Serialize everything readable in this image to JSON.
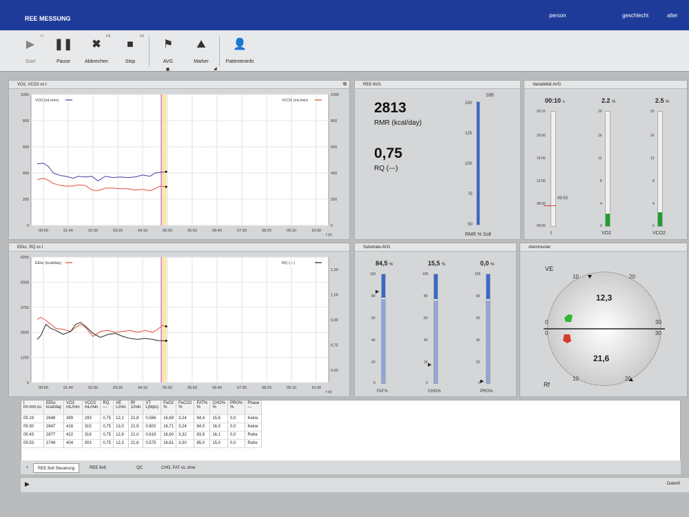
{
  "app": {
    "title": "REE MESSUNG",
    "meta": [
      "person",
      "geschlecht",
      "alter"
    ]
  },
  "toolbar": {
    "buttons": [
      {
        "label": "Start",
        "icon": "play-icon",
        "key": "F5"
      },
      {
        "label": "Pause",
        "icon": "pause-icon",
        "key": ""
      },
      {
        "label": "Abbrechen",
        "icon": "cancel-icon",
        "key": "F8"
      },
      {
        "label": "Stop",
        "icon": "stop-icon",
        "key": "F6"
      },
      {
        "label": "AVG",
        "icon": "flag-icon",
        "key": ""
      },
      {
        "label": "Marker",
        "icon": "marker-icon",
        "key": ""
      },
      {
        "label": "Patienteninfo",
        "icon": "patient-info-icon",
        "key": ""
      }
    ]
  },
  "panels": {
    "vo2": {
      "title": "VO2, VCO2 vs t",
      "legend_left": "VO2 (mL/min)",
      "legend_right": "VCO2 (mL/min)"
    },
    "eekc": {
      "title": "EEkc, RQ vs t",
      "legend_left": "EEkc (kcal/day)",
      "legend_right": "RQ (---)"
    },
    "ree": {
      "title": "REE AVG",
      "value1": "2813",
      "unit1": "RMR (kcal/day)",
      "value2": "0,75",
      "unit2": "RQ (---)",
      "bar_top_label": "186",
      "bar_bottom_label": "RMR % Soll",
      "ticks": [
        "150",
        "125",
        "100",
        "75",
        "50"
      ]
    },
    "var": {
      "title": "Variabilität AVG",
      "t_value": "00:10",
      "t_unit": "s",
      "vo2_value": "2.2",
      "vo2_unit": "%",
      "vco2_value": "2.5",
      "vco2_unit": "%",
      "marker": "05:53",
      "labels": [
        "t",
        "VO2",
        "VCO2"
      ],
      "t_ticks": [
        "00:10",
        "20:00",
        "16:00",
        "12:00",
        "08:00",
        "00:00"
      ],
      "pct_ticks": [
        "20",
        "16",
        "12",
        "8",
        "4",
        "0"
      ]
    },
    "substrate": {
      "title": "Substrate AVG",
      "values": [
        "84,5",
        "15,5",
        "0,0"
      ],
      "unit": "%",
      "labels": [
        "FAT%",
        "CHO%",
        "PRO%"
      ],
      "ticks": [
        "100",
        "80",
        "60",
        "40",
        "20",
        "0"
      ]
    },
    "atem": {
      "title": "Atemmuster",
      "ve_label": "VE",
      "rf_label": "Rf",
      "ve_value": "12,3",
      "rf_value": "21,6",
      "ticks": [
        "10",
        "20",
        "30",
        "0"
      ]
    }
  },
  "chart_data": [
    {
      "type": "line",
      "title": "VO2, VCO2 vs t",
      "x": [
        "00:50",
        "01:40",
        "02:30",
        "03:20",
        "04:10",
        "05:00",
        "05:50",
        "06:40",
        "07:30",
        "08:20",
        "09:10",
        "10:00"
      ],
      "xlabel": "t (s)",
      "ylim": [
        0,
        1000
      ],
      "yticks": [
        "0",
        "200",
        "400",
        "600",
        "800",
        "1000"
      ],
      "series": [
        {
          "name": "VO2 (mL/min)",
          "color": "#3a3aa8",
          "x": [
            0.25,
            0.5,
            0.7,
            0.9,
            1.2,
            1.4,
            1.7,
            1.9,
            2.2,
            2.45,
            2.7,
            3.0,
            3.3,
            3.6,
            3.9,
            4.2,
            4.5,
            4.8,
            5.0,
            5.2,
            5.45
          ],
          "values": [
            470,
            475,
            450,
            400,
            380,
            375,
            360,
            375,
            370,
            375,
            340,
            375,
            365,
            370,
            365,
            370,
            385,
            375,
            400,
            405,
            410
          ]
        },
        {
          "name": "VCO2 (mL/min)",
          "color": "#e04a3a",
          "x": [
            0.25,
            0.5,
            0.7,
            0.9,
            1.2,
            1.4,
            1.7,
            1.9,
            2.2,
            2.45,
            2.7,
            3.0,
            3.3,
            3.6,
            3.9,
            4.2,
            4.5,
            4.8,
            5.0,
            5.2,
            5.45
          ],
          "values": [
            350,
            360,
            345,
            320,
            305,
            300,
            300,
            310,
            305,
            270,
            265,
            285,
            285,
            280,
            280,
            270,
            275,
            265,
            280,
            300,
            295
          ]
        }
      ]
    },
    {
      "type": "line",
      "title": "EEkc, RQ vs t",
      "x": [
        "00:50",
        "01:40",
        "02:30",
        "03:20",
        "04:10",
        "05:00",
        "05:50",
        "06:40",
        "07:30",
        "08:20",
        "09:10",
        "10:00"
      ],
      "xlabel": "t (s)",
      "ylim": [
        0,
        6250
      ],
      "yticks": [
        "0",
        "1250",
        "2500",
        "3750",
        "5000",
        "6250"
      ],
      "y2ticks": [
        "0,60",
        "0,75",
        "0,90",
        "1,05",
        "1,20"
      ],
      "series": [
        {
          "name": "EEkc (kcal/day)",
          "color": "#e04a3a",
          "x": [
            0.25,
            0.4,
            0.6,
            0.8,
            1.0,
            1.3,
            1.6,
            1.8,
            2.0,
            2.2,
            2.5,
            2.8,
            3.1,
            3.4,
            3.7,
            4.0,
            4.3,
            4.6,
            4.9,
            5.1,
            5.3,
            5.45
          ],
          "values": [
            3150,
            3250,
            3100,
            2900,
            2700,
            2650,
            2550,
            2750,
            2900,
            2750,
            2300,
            2550,
            2600,
            2500,
            2550,
            2600,
            2500,
            2600,
            2500,
            2650,
            2850,
            2800
          ]
        },
        {
          "name": "RQ (---)",
          "color": "#222222",
          "x": [
            0.25,
            0.4,
            0.6,
            0.8,
            1.0,
            1.3,
            1.6,
            1.8,
            2.0,
            2.2,
            2.5,
            2.8,
            3.1,
            3.4,
            3.7,
            4.0,
            4.3,
            4.6,
            4.9,
            5.1,
            5.3,
            5.45
          ],
          "values": [
            2150,
            2350,
            2900,
            2700,
            2600,
            2400,
            2550,
            2900,
            3000,
            2800,
            2450,
            2250,
            2400,
            2450,
            2300,
            2200,
            2150,
            2200,
            2150,
            2100,
            2080,
            2080
          ]
        }
      ]
    }
  ],
  "table": {
    "headers": [
      [
        "t",
        "hh:mm:ss"
      ],
      [
        "EEkc",
        "kcal/day"
      ],
      [
        "VO2",
        "mL/min"
      ],
      [
        "VCO2",
        "mL/min"
      ],
      [
        "RQ",
        "---"
      ],
      [
        "VE",
        "L/min"
      ],
      [
        "Rf",
        "1/min"
      ],
      [
        "VT",
        "L(btps)"
      ],
      [
        "FeO2",
        "%"
      ],
      [
        "FeCO2",
        "%"
      ],
      [
        "FAT%",
        "%"
      ],
      [
        "CHO%",
        "%"
      ],
      [
        "PRO%",
        "%"
      ],
      [
        "Phase",
        "---"
      ]
    ],
    "rows": [
      [
        "05:19",
        "2648",
        "389",
        "293",
        "0,75",
        "12,1",
        "21,8",
        "0,566",
        "16,69",
        "3,24",
        "84,4",
        "15,6",
        "0,0",
        "Keine"
      ],
      [
        "05:30",
        "2847",
        "418",
        "315",
        "0,75",
        "13,0",
        "21,9",
        "0,602",
        "16,71",
        "3,24",
        "84,0",
        "16,0",
        "0,0",
        "Keine"
      ],
      [
        "05:43",
        "2877",
        "422",
        "319",
        "0,75",
        "12,9",
        "21,0",
        "0,619",
        "16,60",
        "3,32",
        "83,9",
        "16,1",
        "0,0",
        "Ruhe"
      ],
      [
        "05:53",
        "2749",
        "404",
        "303",
        "0,75",
        "12,3",
        "21,6",
        "0,575",
        "16,61",
        "3,30",
        "85,0",
        "15,0",
        "0,0",
        "Ruhe"
      ]
    ]
  },
  "tabs": [
    "REE 8x8 Steuerung",
    "REE 8x8",
    "QC",
    "CHO, FAT vs. time"
  ],
  "status": {
    "right": "Datenfl"
  }
}
